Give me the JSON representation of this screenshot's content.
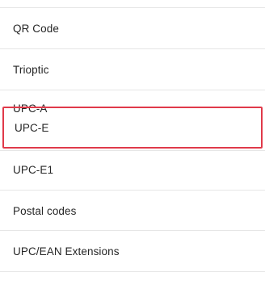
{
  "list": {
    "items": [
      {
        "label": "QR Code"
      },
      {
        "label": "Trioptic"
      },
      {
        "label": "UPC-A"
      },
      {
        "label": "UPC-E"
      },
      {
        "label": "UPC-E1"
      },
      {
        "label": "Postal codes"
      },
      {
        "label": "UPC/EAN Extensions"
      }
    ],
    "selected_label": "UPC-E",
    "highlight_color": "#e03a4a"
  }
}
